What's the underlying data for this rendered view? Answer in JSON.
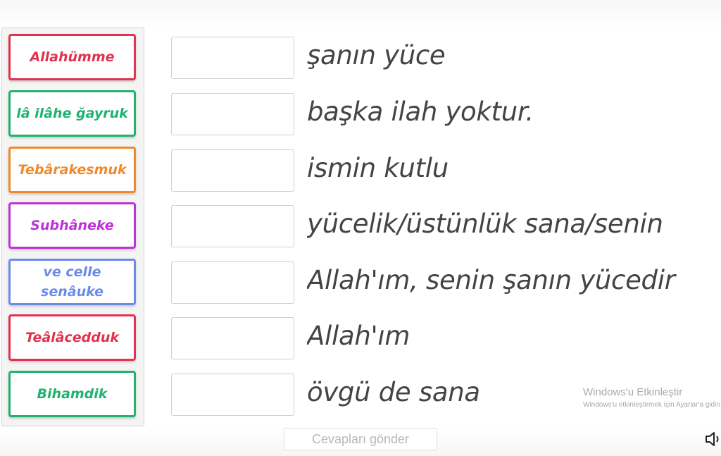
{
  "cards": [
    {
      "label": "Allahümme",
      "color": "#e0334e"
    },
    {
      "label": "lâ ilâhe ğayruk",
      "color": "#1fb36f"
    },
    {
      "label": "Tebârakesmuk",
      "color": "#f0892c"
    },
    {
      "label": "Subhâneke",
      "color": "#bd32d6"
    },
    {
      "label": "ve celle senâuke",
      "color": "#6a8ce8"
    },
    {
      "label": "Teâlâcedduk",
      "color": "#e0334e"
    },
    {
      "label": "Bihamdik",
      "color": "#1fb36f"
    }
  ],
  "meanings": [
    "şanın yüce",
    "başka ilah yoktur.",
    "ismin kutlu",
    "yücelik/üstünlük sana/senin",
    "Allah'ım, senin şanın yücedir",
    "Allah'ım",
    "övgü de sana"
  ],
  "submit_label": "Cevapları gönder",
  "watermark": {
    "title": "Windows'u Etkinleştir",
    "subtitle": "Windows'u etkinleştirmek için Ayarlar'a gidin."
  },
  "icons": {
    "sound": "speaker-icon"
  }
}
